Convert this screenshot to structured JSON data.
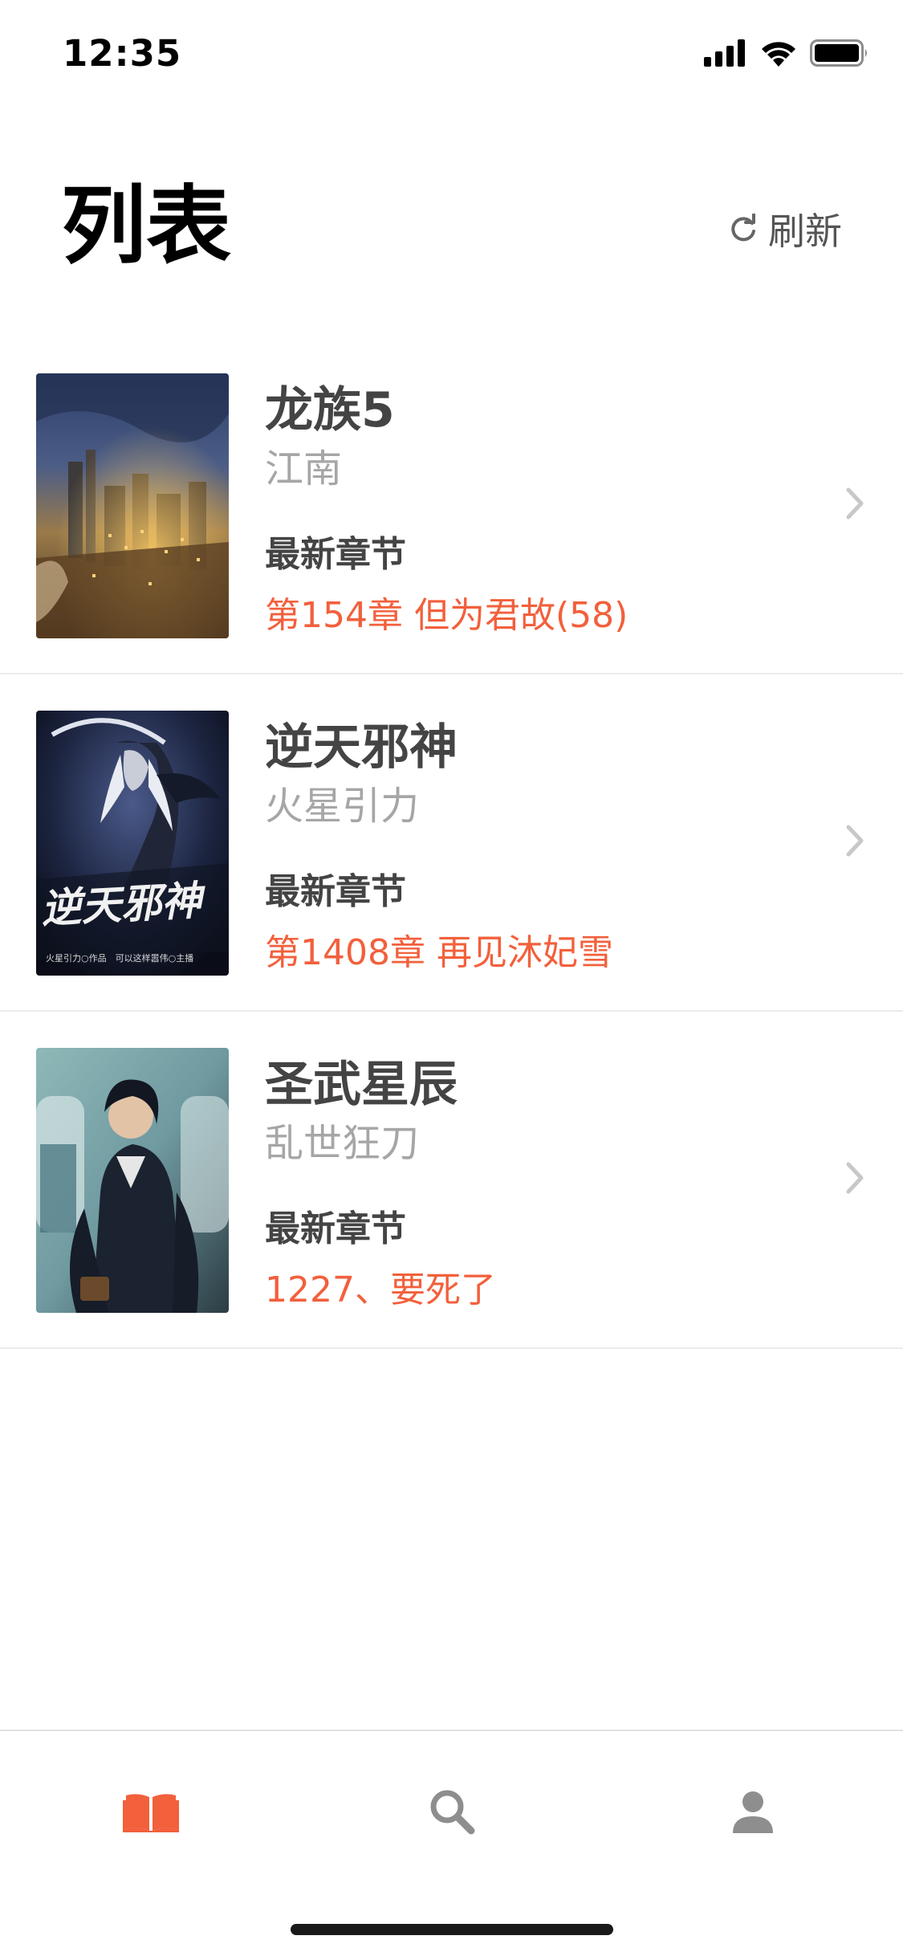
{
  "status_bar": {
    "time": "12:35"
  },
  "header": {
    "title": "列表",
    "refresh_label": "刷新",
    "refresh_icon": "refresh-icon"
  },
  "books": [
    {
      "title": "龙族5",
      "author": "江南",
      "latest_label": "最新章节",
      "latest_chapter": "第154章 但为君故(58)"
    },
    {
      "title": "逆天邪神",
      "author": "火星引力",
      "latest_label": "最新章节",
      "latest_chapter": "第1408章 再见沐妃雪",
      "cover_text": "逆天邪神",
      "cover_footer": "火星引力○作品　可以这样嚣伟○主播"
    },
    {
      "title": "圣武星辰",
      "author": "乱世狂刀",
      "latest_label": "最新章节",
      "latest_chapter": "1227、要死了"
    }
  ],
  "tab_bar": {
    "tabs": [
      {
        "icon": "book-icon",
        "active": true
      },
      {
        "icon": "search-icon",
        "active": false
      },
      {
        "icon": "user-icon",
        "active": false
      }
    ]
  },
  "colors": {
    "accent": "#f2603c",
    "text_primary": "#444444",
    "text_secondary": "#a6a6a6",
    "tab_inactive": "#8e8e8e",
    "divider": "#ececec"
  }
}
